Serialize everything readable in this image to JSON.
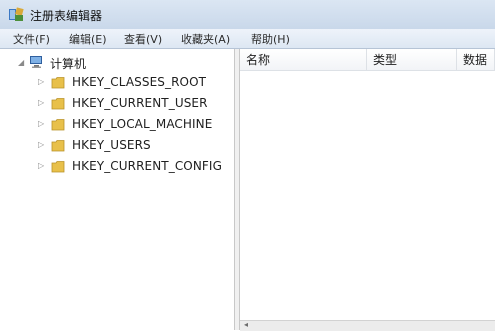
{
  "window": {
    "title": "注册表编辑器"
  },
  "menu": {
    "items": [
      {
        "label": "文件(F)"
      },
      {
        "label": "编辑(E)"
      },
      {
        "label": "查看(V)"
      },
      {
        "label": "收藏夹(A)"
      },
      {
        "label": "帮助(H)"
      }
    ]
  },
  "tree": {
    "root": {
      "label": "计算机",
      "icon": "computer-icon",
      "expanded": true
    },
    "items": [
      {
        "label": "HKEY_CLASSES_ROOT",
        "icon": "folder-icon"
      },
      {
        "label": "HKEY_CURRENT_USER",
        "icon": "folder-icon"
      },
      {
        "label": "HKEY_LOCAL_MACHINE",
        "icon": "folder-icon"
      },
      {
        "label": "HKEY_USERS",
        "icon": "folder-icon"
      },
      {
        "label": "HKEY_CURRENT_CONFIG",
        "icon": "folder-icon"
      }
    ]
  },
  "list": {
    "columns": [
      {
        "label": "名称"
      },
      {
        "label": "类型"
      },
      {
        "label": "数据"
      }
    ]
  },
  "colors": {
    "titlebar": "#c9d8ea",
    "menubar": "#dde7f3",
    "folder": "#e8c04a"
  }
}
